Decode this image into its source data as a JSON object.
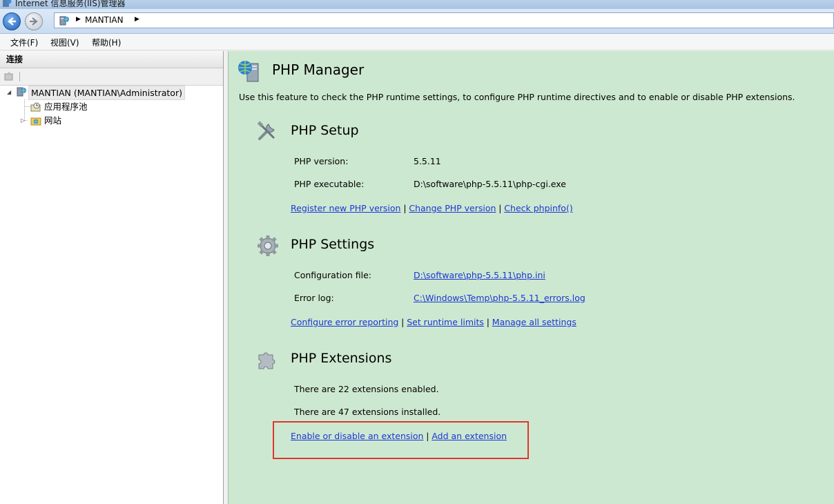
{
  "window": {
    "title": "Internet 信息服务(IIS)管理器"
  },
  "address": {
    "crumbs": [
      "MANTIAN"
    ]
  },
  "menu": {
    "items": [
      "文件(F)",
      "视图(V)",
      "帮助(H)"
    ]
  },
  "connections": {
    "header": "连接",
    "tree": {
      "root": "MANTIAN (MANTIAN\\Administrator)",
      "children": [
        "应用程序池",
        "网站"
      ]
    }
  },
  "main": {
    "title": "PHP Manager",
    "description": "Use this feature to check the PHP runtime settings, to configure PHP runtime directives and to enable or disable PHP extensions.",
    "setup": {
      "title": "PHP Setup",
      "version_label": "PHP version:",
      "version_value": "5.5.11",
      "exe_label": "PHP executable:",
      "exe_value": "D:\\software\\php-5.5.11\\php-cgi.exe",
      "links": [
        "Register new PHP version",
        "Change PHP version",
        "Check phpinfo()"
      ]
    },
    "settings": {
      "title": "PHP Settings",
      "config_label": "Configuration file:",
      "config_value": "D:\\software\\php-5.5.11\\php.ini",
      "errorlog_label": "Error log:",
      "errorlog_value": "C:\\Windows\\Temp\\php-5.5.11_errors.log",
      "links": [
        "Configure error reporting",
        "Set runtime limits",
        "Manage all settings"
      ]
    },
    "extensions": {
      "title": "PHP Extensions",
      "enabled_text": "There are 22 extensions enabled.",
      "installed_text": "There are 47 extensions installed.",
      "links": [
        "Enable or disable an extension",
        "Add an extension"
      ]
    }
  },
  "colors": {
    "content_bg": "#cde8d0",
    "link": "#1c35d6",
    "highlight": "#e0352e"
  }
}
